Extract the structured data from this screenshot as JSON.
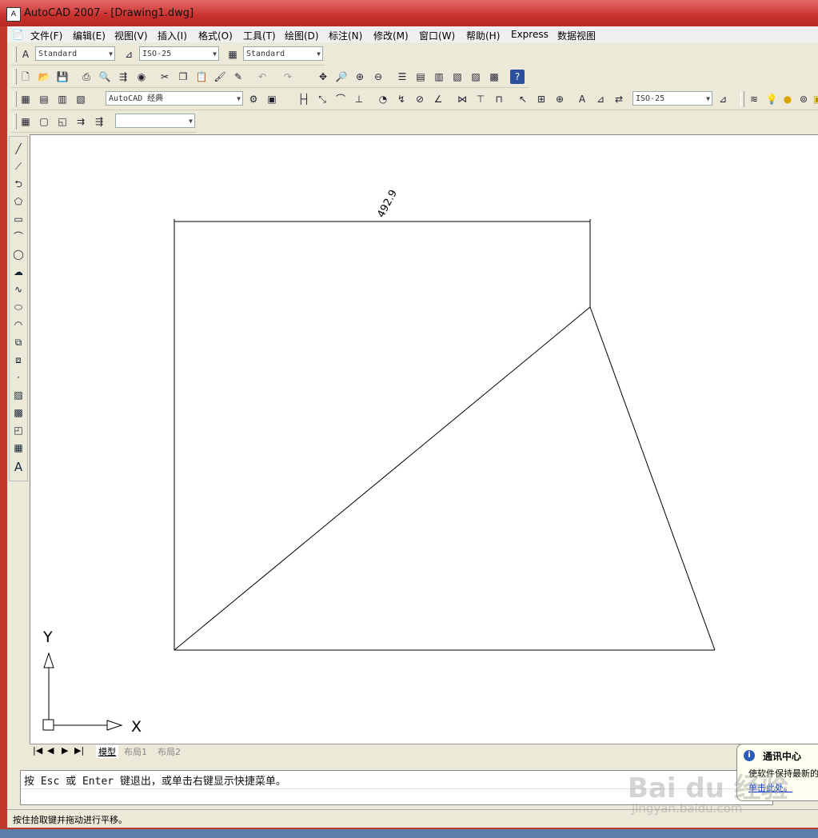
{
  "window": {
    "title": "AutoCAD 2007 - [Drawing1.dwg]",
    "app_icon": "autocad-app-icon"
  },
  "menu": [
    "文件(F)",
    "编辑(E)",
    "视图(V)",
    "插入(I)",
    "格式(O)",
    "工具(T)",
    "绘图(D)",
    "标注(N)",
    "修改(M)",
    "窗口(W)",
    "帮助(H)",
    "Express",
    "数据视图"
  ],
  "styles_toolbar": {
    "text_style": "Standard",
    "dim_style": "ISO-25",
    "table_style": "Standard"
  },
  "workspace_toolbar": {
    "workspace": "AutoCAD 经典",
    "dim_style2": "ISO-25"
  },
  "layer_toolbar": {
    "layer": ""
  },
  "drawing": {
    "dimension_label": "492.9",
    "ucs_y": "Y",
    "ucs_x": "X"
  },
  "tabs": {
    "model": "模型",
    "layout1": "布局1",
    "layout2": "布局2"
  },
  "command": {
    "prompt": "按 Esc 或 Enter 键退出，或单击右键显示快捷菜单。"
  },
  "status": {
    "text": "按住拾取键并拖动进行平移。"
  },
  "balloon": {
    "title": "通讯中心",
    "line1": "使软件保持最新的",
    "link": "单击此处。"
  },
  "watermark": {
    "brand": "Bai du 经验",
    "url": "jingyan.baidu.com"
  }
}
